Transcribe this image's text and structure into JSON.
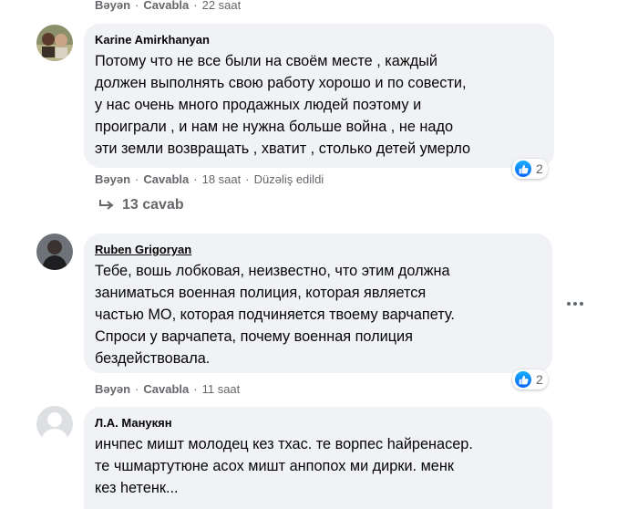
{
  "top_actions": {
    "like": "Bəyən",
    "reply": "Cavabla",
    "time": "22 saat"
  },
  "comments": [
    {
      "author": "Karine Amirkhanyan",
      "text": "Потому что не все были на своём месте , каждый\nдолжен выполнять свою работу хорошо и по совести,\nу нас очень много продажных людей поэтому и\nпроиграли , и нам не нужна больше война , не надо\nэти земли возвращать , хватит , столько детей умерло",
      "actions": {
        "like": "Bəyən",
        "reply": "Cavabla",
        "time": "18 saat",
        "edited": "Düzəliş edildi"
      },
      "reactions": "2",
      "reaction_icon": "like-icon",
      "replies": "13 cavab"
    },
    {
      "author": "Ruben Grigoryan",
      "text": "Тебе, вошь лобковая, неизвестно, что этим должна\nзаниматься военная полиция, которая является\nчастью МО, которая подчиняется твоему варчапету.\nСпроси у варчапета, почему военная полиция\nбездействовала.",
      "actions": {
        "like": "Bəyən",
        "reply": "Cavabla",
        "time": "11 saat"
      },
      "reactions": "2",
      "reaction_icon": "like-icon"
    },
    {
      "author": "Л.А. Манукян",
      "text": "инчпес мишт молодец кез тхас. те ворпес hайренасер.\nте чшмартутюне асох мишт анпопох ми дирки. менк\nкез hетенк..."
    }
  ]
}
